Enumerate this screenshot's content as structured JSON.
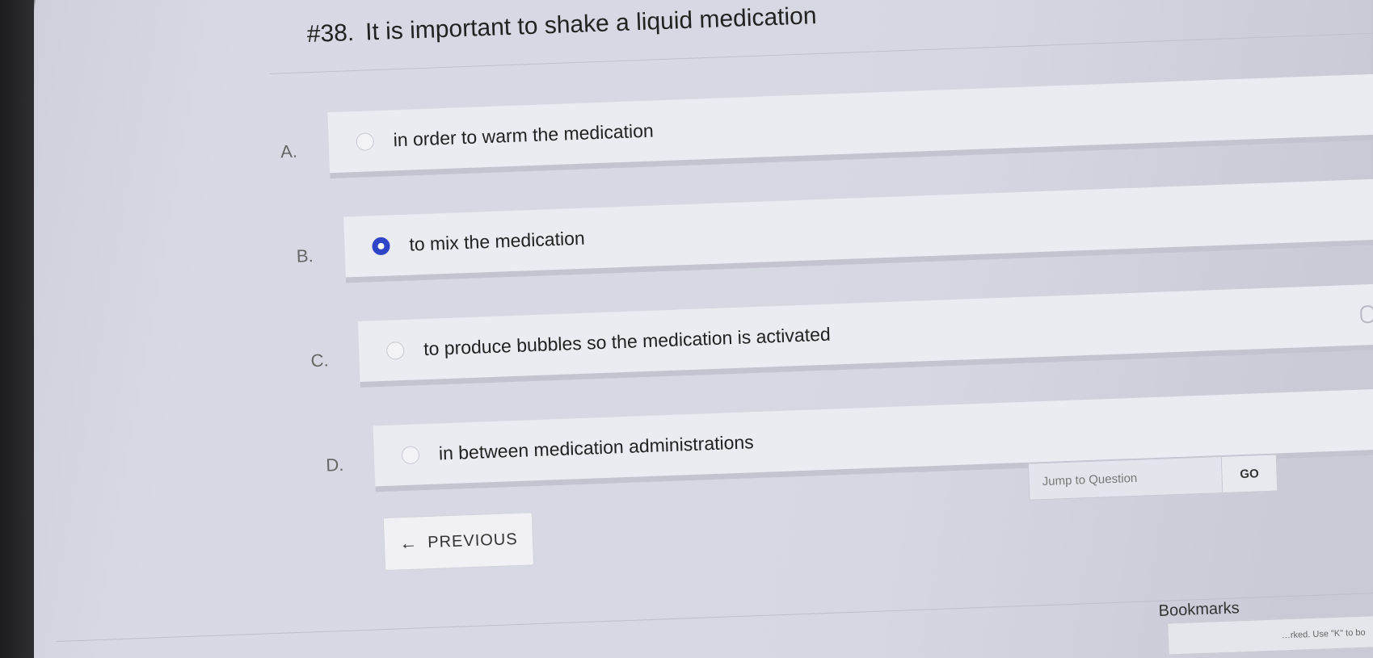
{
  "question": {
    "number": "#38.",
    "text": "It is important to shake a liquid medication"
  },
  "options": [
    {
      "letter": "A.",
      "text": "in order to warm the medication",
      "selected": false
    },
    {
      "letter": "B.",
      "text": "to mix the medication",
      "selected": true
    },
    {
      "letter": "C.",
      "text": "to produce bubbles so the medication is activated",
      "selected": false
    },
    {
      "letter": "D.",
      "text": "in between medication administrations",
      "selected": false
    }
  ],
  "nav": {
    "previous_label": "PREVIOUS",
    "previous_arrow": "←"
  },
  "jump": {
    "placeholder": "Jump to Question",
    "go_label": "GO"
  },
  "bookmarks": {
    "label": "Bookmarks",
    "hint": "…rked. Use \"K\" to bo"
  },
  "colors": {
    "accent": "#2f45c7"
  }
}
